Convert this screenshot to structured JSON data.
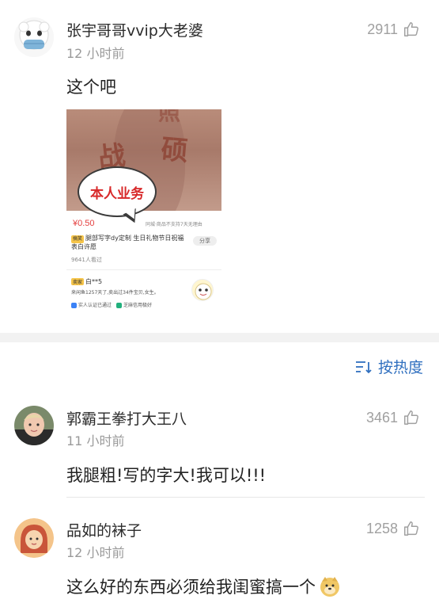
{
  "comments": [
    {
      "username": "张宇哥哥vvip大老婆",
      "time": "12 小时前",
      "likes": "2911",
      "text": "这个吧",
      "avatar_icon": "sheep-mask-avatar",
      "image": {
        "overlay_chars": [
          "战",
          "硕",
          "照"
        ],
        "bubble_text": "本人业务",
        "price": "¥0.50",
        "note_right": "同城·商品不支持7天无理由",
        "tag": "搞笑",
        "product_title": "腿部写字dy定制 生日礼物节日祝福表白许愿",
        "share": "分享",
        "sold": "9641人看过",
        "seller_name": "白**5",
        "seller_desc": "来闲鱼1257天了,卖出过34件宝贝,女生。",
        "verify_1": "实人认证已通过",
        "verify_2": "芝麻信用极好"
      }
    },
    {
      "username": "郭霸王拳打大王八",
      "time": "11 小时前",
      "likes": "3461",
      "text": "我腿粗!写的字大!我可以!!!",
      "avatar_icon": "child-photo-avatar"
    },
    {
      "username": "品如的袜子",
      "time": "12 小时前",
      "likes": "1258",
      "text": "这么好的东西必须给我闺蜜搞一个",
      "avatar_icon": "cartoon-girl-avatar",
      "emoji": "doge-emoji"
    }
  ],
  "sort": {
    "label": "按热度",
    "icon": "sort-icon"
  },
  "colors": {
    "link_blue": "#2f6fbf",
    "muted": "#9a9a9a",
    "bubble_red": "#d8292a"
  }
}
